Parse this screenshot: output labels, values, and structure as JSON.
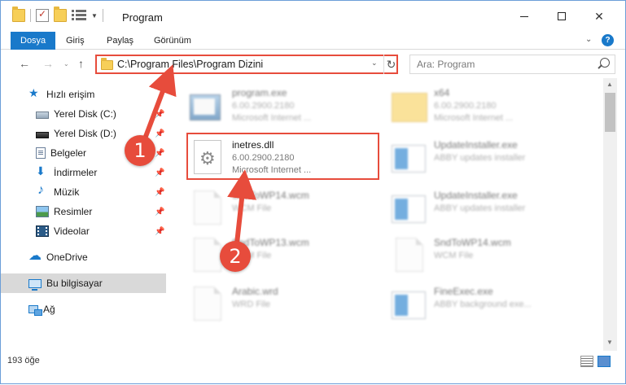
{
  "window": {
    "title": "Program",
    "min_icon": "minimize-icon",
    "max_icon": "maximize-icon",
    "close_glyph": "✕"
  },
  "ribbon": {
    "tabs": [
      "Dosya",
      "Giriş",
      "Paylaş",
      "Görünüm"
    ],
    "collapse_glyph": "⌄",
    "help_glyph": "?",
    "accent": "#1979ca"
  },
  "address": {
    "back_glyph": "←",
    "forward_glyph": "→",
    "recent_glyph": "⌄",
    "up_glyph": "↑",
    "path": "C:\\Program Files\\Program Dizini",
    "dropdown_glyph": "⌄",
    "refresh_glyph": "↻",
    "search_placeholder": "Ara: Program"
  },
  "sidebar": {
    "quick_access": "Hızlı erişim",
    "pinned": [
      {
        "label": "Yerel Disk (C:)",
        "icon": "disk-c-icon"
      },
      {
        "label": "Yerel Disk (D:)",
        "icon": "disk-d-icon"
      },
      {
        "label": "Belgeler",
        "icon": "documents-icon"
      },
      {
        "label": "İndirmeler",
        "icon": "downloads-icon"
      },
      {
        "label": "Müzik",
        "icon": "music-icon"
      },
      {
        "label": "Resimler",
        "icon": "pictures-icon"
      },
      {
        "label": "Videolar",
        "icon": "videos-icon"
      }
    ],
    "pin_glyph": "📌",
    "onedrive": "OneDrive",
    "this_pc": "Bu bilgisayar",
    "network": "Ağ"
  },
  "files": [
    {
      "name": "program.exe",
      "line2": "6.00.2900.2180",
      "line3": "Microsoft Internet ...",
      "icon": "exe-icon",
      "blurred": true
    },
    {
      "name": "x64",
      "line2": "6.00.2900.2180",
      "line3": "Microsoft Internet ...",
      "icon": "folder-icon",
      "blurred": true
    },
    {
      "name": "inetres.dll",
      "line2": "6.00.2900.2180",
      "line3": "Microsoft Internet ...",
      "icon": "dll-gear-icon",
      "blurred": false
    },
    {
      "name": "UpdateInstaller.exe",
      "line2": "ABBY updates installer",
      "line3": "",
      "icon": "installer-icon",
      "blurred": true
    },
    {
      "name": "SndToWP14.wcm",
      "line2": "WCM File",
      "line3": "",
      "icon": "document-icon",
      "blurred": true
    },
    {
      "name": "UpdateInstaller.exe",
      "line2": "ABBY updates installer",
      "line3": "",
      "icon": "installer-icon",
      "blurred": true
    },
    {
      "name": "SndToWP13.wcm",
      "line2": "WCM File",
      "line3": "",
      "icon": "document-icon",
      "blurred": true
    },
    {
      "name": "SndToWP14.wcm",
      "line2": "WCM File",
      "line3": "",
      "icon": "document-icon",
      "blurred": true
    },
    {
      "name": "Arabic.wrd",
      "line2": "WRD File",
      "line3": "",
      "icon": "document-icon",
      "blurred": true
    },
    {
      "name": "FineExec.exe",
      "line2": "ABBY background exe...",
      "line3": "",
      "icon": "installer-icon",
      "blurred": true
    }
  ],
  "annotations": {
    "badge1": "1",
    "badge2": "2",
    "color": "#e74c3c"
  },
  "status": {
    "item_count": "193 öğe"
  }
}
